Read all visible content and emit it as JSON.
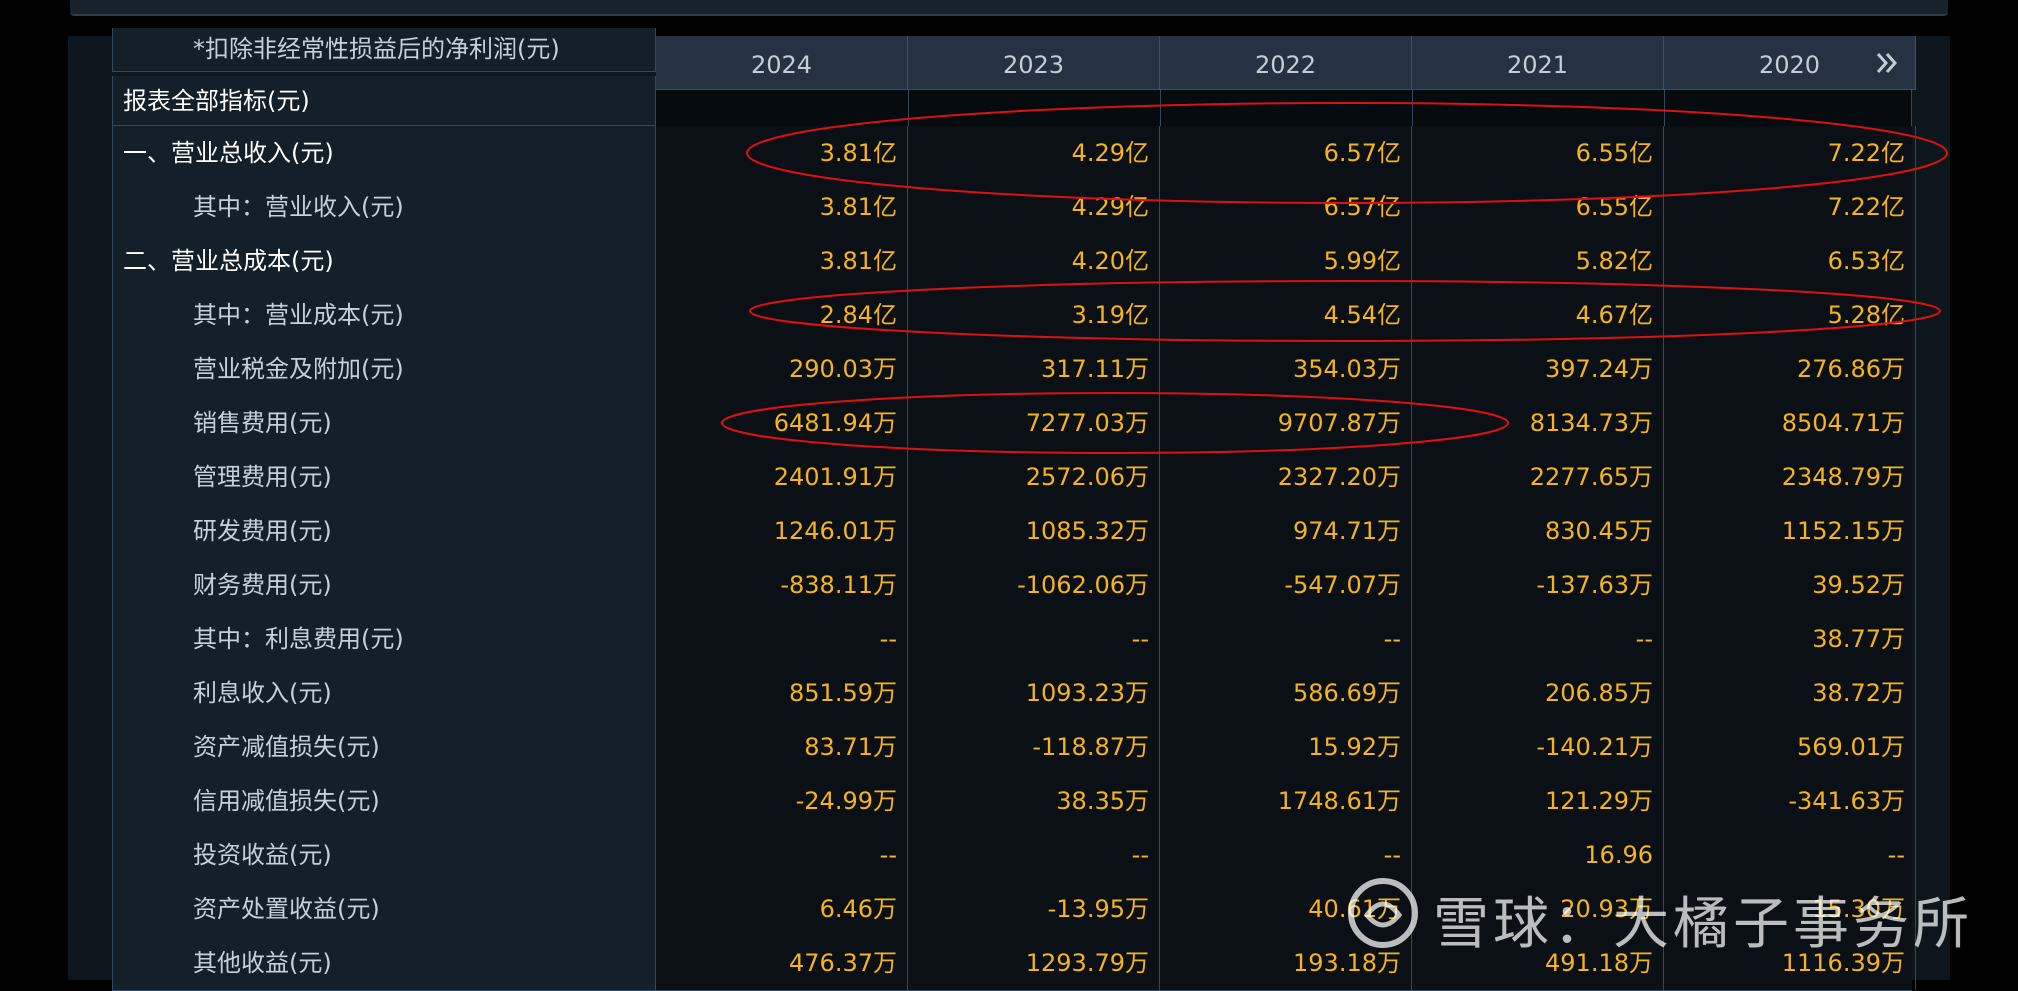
{
  "header": {
    "cut_label": "*扣除非经常性损益后的净利润(元)",
    "group_label": "报表全部指标(元)",
    "years": [
      "2024",
      "2023",
      "2022",
      "2021",
      "2020"
    ],
    "more_icon": "double-chevron-right-icon"
  },
  "rows": [
    {
      "label": "一、营业总收入(元)",
      "level": "top",
      "values": [
        "3.81亿",
        "4.29亿",
        "6.57亿",
        "6.55亿",
        "7.22亿"
      ]
    },
    {
      "label": "其中：营业收入(元)",
      "level": "sub",
      "values": [
        "3.81亿",
        "4.29亿",
        "6.57亿",
        "6.55亿",
        "7.22亿"
      ]
    },
    {
      "label": "二、营业总成本(元)",
      "level": "top",
      "values": [
        "3.81亿",
        "4.20亿",
        "5.99亿",
        "5.82亿",
        "6.53亿"
      ]
    },
    {
      "label": "其中：营业成本(元)",
      "level": "sub",
      "values": [
        "2.84亿",
        "3.19亿",
        "4.54亿",
        "4.67亿",
        "5.28亿"
      ]
    },
    {
      "label": "营业税金及附加(元)",
      "level": "sub",
      "values": [
        "290.03万",
        "317.11万",
        "354.03万",
        "397.24万",
        "276.86万"
      ]
    },
    {
      "label": "销售费用(元)",
      "level": "sub",
      "values": [
        "6481.94万",
        "7277.03万",
        "9707.87万",
        "8134.73万",
        "8504.71万"
      ]
    },
    {
      "label": "管理费用(元)",
      "level": "sub",
      "values": [
        "2401.91万",
        "2572.06万",
        "2327.20万",
        "2277.65万",
        "2348.79万"
      ]
    },
    {
      "label": "研发费用(元)",
      "level": "sub",
      "values": [
        "1246.01万",
        "1085.32万",
        "974.71万",
        "830.45万",
        "1152.15万"
      ]
    },
    {
      "label": "财务费用(元)",
      "level": "sub",
      "values": [
        "-838.11万",
        "-1062.06万",
        "-547.07万",
        "-137.63万",
        "39.52万"
      ]
    },
    {
      "label": "其中：利息费用(元)",
      "level": "sub",
      "values": [
        "--",
        "--",
        "--",
        "--",
        "38.77万"
      ]
    },
    {
      "label": "利息收入(元)",
      "level": "sub",
      "values": [
        "851.59万",
        "1093.23万",
        "586.69万",
        "206.85万",
        "38.72万"
      ]
    },
    {
      "label": "资产减值损失(元)",
      "level": "sub",
      "values": [
        "83.71万",
        "-118.87万",
        "15.92万",
        "-140.21万",
        "569.01万"
      ]
    },
    {
      "label": "信用减值损失(元)",
      "level": "sub",
      "values": [
        "-24.99万",
        "38.35万",
        "1748.61万",
        "121.29万",
        "-341.63万"
      ]
    },
    {
      "label": "投资收益(元)",
      "level": "sub",
      "values": [
        "--",
        "--",
        "--",
        "16.96",
        "--"
      ]
    },
    {
      "label": "资产处置收益(元)",
      "level": "sub",
      "values": [
        "6.46万",
        "-13.95万",
        "40.61万",
        "20.93万",
        "15.30万"
      ]
    },
    {
      "label": "其他收益(元)",
      "level": "sub",
      "values": [
        "476.37万",
        "1293.79万",
        "193.18万",
        "491.18万",
        "1116.39万"
      ]
    }
  ],
  "annotations": {
    "color": "#e01010"
  },
  "watermark": {
    "text": "雪球：大橘子事务所"
  }
}
